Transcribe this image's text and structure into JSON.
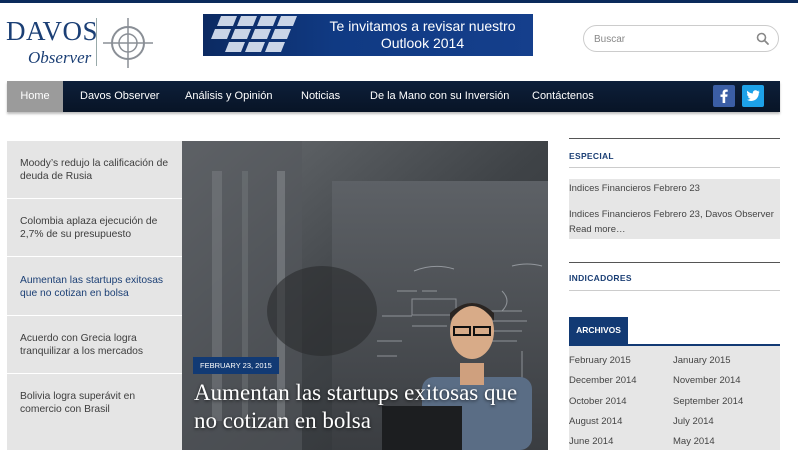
{
  "header": {
    "logo_primary": "DAVOS",
    "logo_secondary": "Observer",
    "banner": {
      "line1": "Te invitamos a revisar nuestro",
      "line2": "Outlook 2014"
    },
    "search": {
      "placeholder": "Buscar"
    }
  },
  "nav": {
    "items": [
      {
        "label": "Home",
        "active": true
      },
      {
        "label": "Davos Observer"
      },
      {
        "label": "Análisis y Opinión"
      },
      {
        "label": "Noticias"
      },
      {
        "label": "De la Mano con su Inversión"
      },
      {
        "label": "Contáctenos"
      }
    ],
    "social": [
      "facebook-icon",
      "twitter-icon"
    ]
  },
  "headlines": [
    {
      "text": "Moody’s redujo la calificación de deuda de Rusia"
    },
    {
      "text": "Colombia aplaza ejecución de 2,7% de su presupuesto"
    },
    {
      "text": "Aumentan las startups exitosas que no cotizan en bolsa",
      "current": true
    },
    {
      "text": "Acuerdo con Grecia logra tranquilizar a los mercados"
    },
    {
      "text": "Bolivia logra superávit en comercio con Brasil"
    }
  ],
  "hero": {
    "date": "FEBRUARY 23, 2015",
    "title": "Aumentan las startups exitosas que no cotizan en bolsa"
  },
  "sidebar": {
    "especial": {
      "heading": "ESPECIAL",
      "link1": "Indices Financieros Febrero 23",
      "link2": "Indices Financieros Febrero 23, Davos Observer",
      "read_more": "Read more…"
    },
    "indicadores": {
      "heading": "INDICADORES"
    },
    "archivos": {
      "heading": "ARCHIVOS",
      "months": [
        "February 2015",
        "January 2015",
        "December 2014",
        "November 2014",
        "October 2014",
        "September 2014",
        "August 2014",
        "July 2014",
        "June 2014",
        "May 2014"
      ]
    }
  },
  "colors": {
    "navy": "#123a74",
    "nav_bg": "#0d1f3a",
    "facebook": "#3b5ea5",
    "twitter": "#1da1e8"
  }
}
